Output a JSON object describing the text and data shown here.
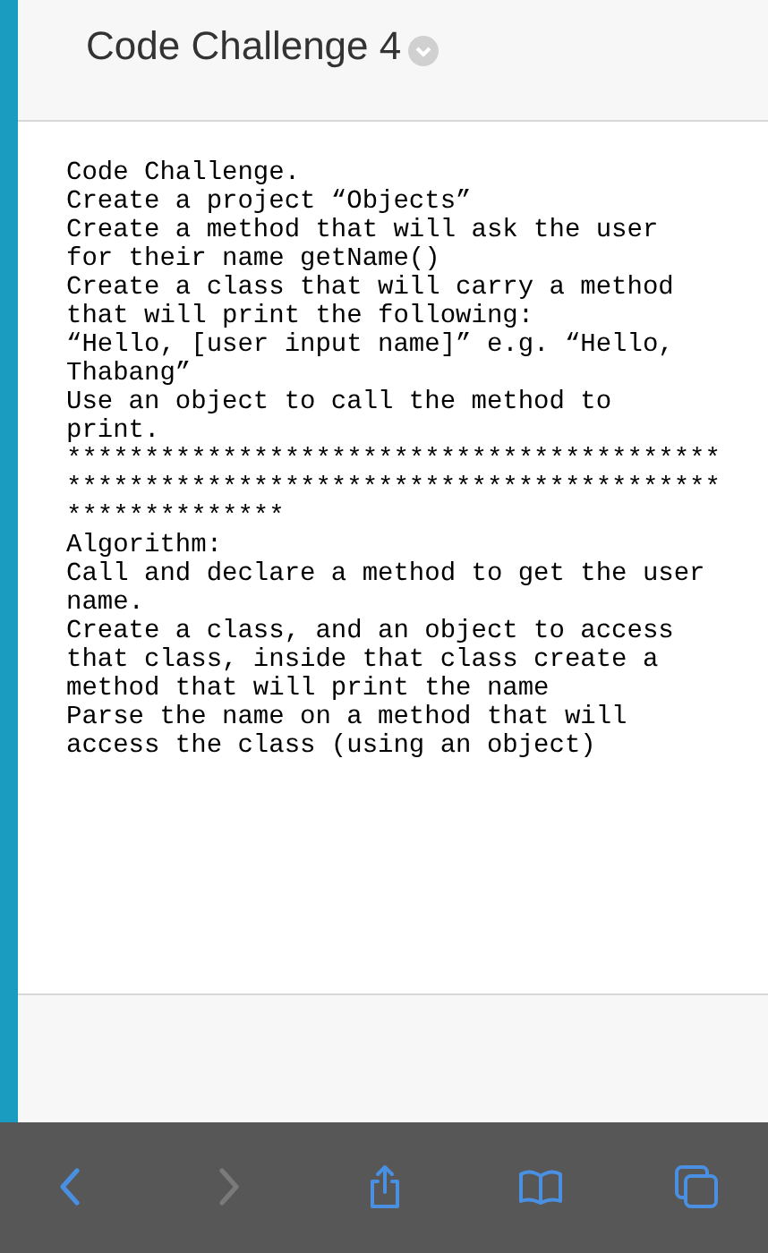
{
  "header": {
    "title": "Code Challenge 4"
  },
  "body": {
    "lines": [
      "Code Challenge.",
      "Create a project “Objects”",
      "Create a method that will ask the user",
      "for their name getName()",
      "Create a class that will carry a method",
      "that will print the following:",
      "“Hello, [user input name]” e.g. “Hello,",
      "Thabang”",
      "Use an object to call the method to",
      "print.",
      "******************************************",
      "******************************************",
      "**************",
      "Algorithm:",
      "Call and declare a method to get the user",
      "name.",
      "Create a class, and an object to access",
      "that class, inside that class create a",
      "method that will print the name",
      "Parse the name on a method that will",
      "access the class (using an object)"
    ]
  },
  "toolbar": {
    "buttons": [
      {
        "kind": "back",
        "disabled": false
      },
      {
        "kind": "forward",
        "disabled": true
      },
      {
        "kind": "share",
        "disabled": false
      },
      {
        "kind": "bookmarks",
        "disabled": false
      },
      {
        "kind": "tabs",
        "disabled": false
      }
    ]
  }
}
